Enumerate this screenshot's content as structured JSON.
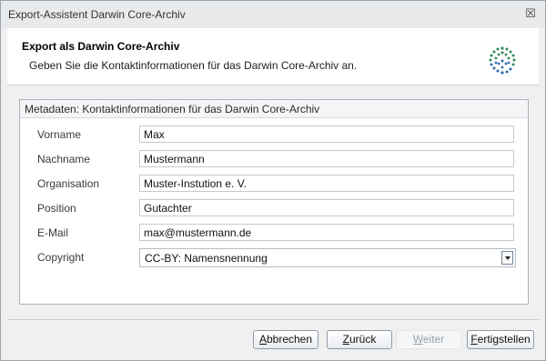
{
  "window": {
    "title": "Export-Assistent Darwin Core-Archiv",
    "close_glyph": "☒"
  },
  "header": {
    "title": "Export als Darwin Core-Archiv",
    "subtitle": "Geben Sie die Kontaktinformationen für das Darwin Core-Archiv an.",
    "logo_icon": "gbif-logo-icon"
  },
  "panel": {
    "title": "Metadaten: Kontaktinformationen für das Darwin Core-Archiv",
    "fields": [
      {
        "label": "Vorname",
        "value": "Max"
      },
      {
        "label": "Nachname",
        "value": "Mustermann"
      },
      {
        "label": "Organisation",
        "value": "Muster-Instution e. V."
      },
      {
        "label": "Position",
        "value": "Gutachter"
      },
      {
        "label": "E-Mail",
        "value": "max@mustermann.de"
      }
    ],
    "copyright": {
      "label": "Copyright",
      "value": "CC-BY: Namensnennung"
    }
  },
  "buttons": {
    "cancel": {
      "accel": "A",
      "rest": "bbrechen"
    },
    "back": {
      "accel": "Z",
      "rest": "urück"
    },
    "next": {
      "accel": "W",
      "rest": "eiter"
    },
    "finish": {
      "accel": "F",
      "rest": "ertigstellen"
    }
  },
  "colors": {
    "logo_green": "#2e8b57",
    "logo_blue": "#2f6db5"
  }
}
